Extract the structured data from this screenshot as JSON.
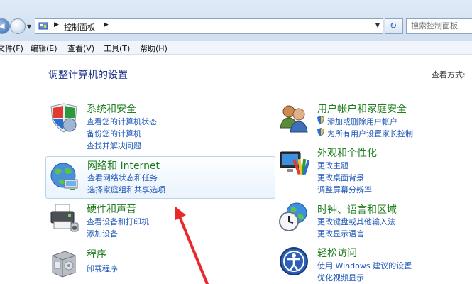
{
  "address": {
    "breadcrumb": "控制面板",
    "search_placeholder": "搜索控制面板"
  },
  "menu": [
    {
      "label": "文件(F)"
    },
    {
      "label": "编辑(E)"
    },
    {
      "label": "查看(V)"
    },
    {
      "label": "工具(T)"
    },
    {
      "label": "帮助(H)"
    }
  ],
  "page": {
    "title": "调整计算机的设置",
    "view_by": "查看方式:"
  },
  "categories": {
    "system": {
      "title": "系统和安全",
      "icon": "security-shield-icon",
      "links": [
        "查看您的计算机状态",
        "备份您的计算机",
        "查找并解决问题"
      ]
    },
    "network": {
      "title": "网络和 Internet",
      "icon": "network-globe-icon",
      "links": [
        "查看网络状态和任务",
        "选择家庭组和共享选项"
      ]
    },
    "hardware": {
      "title": "硬件和声音",
      "icon": "printer-icon",
      "links": [
        "查看设备和打印机",
        "添加设备"
      ]
    },
    "programs": {
      "title": "程序",
      "icon": "programs-box-icon",
      "links": [
        "卸载程序"
      ]
    },
    "users": {
      "title": "用户帐户和家庭安全",
      "icon": "users-icon",
      "links": [
        "添加或删除用户帐户",
        "为所有用户设置家长控制"
      ]
    },
    "appearance": {
      "title": "外观和个性化",
      "icon": "monitor-palette-icon",
      "links": [
        "更改主题",
        "更改桌面背景",
        "调整屏幕分辨率"
      ]
    },
    "clock": {
      "title": "时钟、语言和区域",
      "icon": "clock-globe-icon",
      "links": [
        "更改键盘或其他输入法",
        "更改显示语言"
      ]
    },
    "ease": {
      "title": "轻松访问",
      "icon": "ease-of-access-icon",
      "links": [
        "使用 Windows 建议的设置",
        "优化视频显示"
      ]
    }
  },
  "colors": {
    "category_title": "#1e7d1e",
    "link": "#1f58b8",
    "page_title": "#1e3287",
    "annotation_arrow": "#e8282a"
  }
}
